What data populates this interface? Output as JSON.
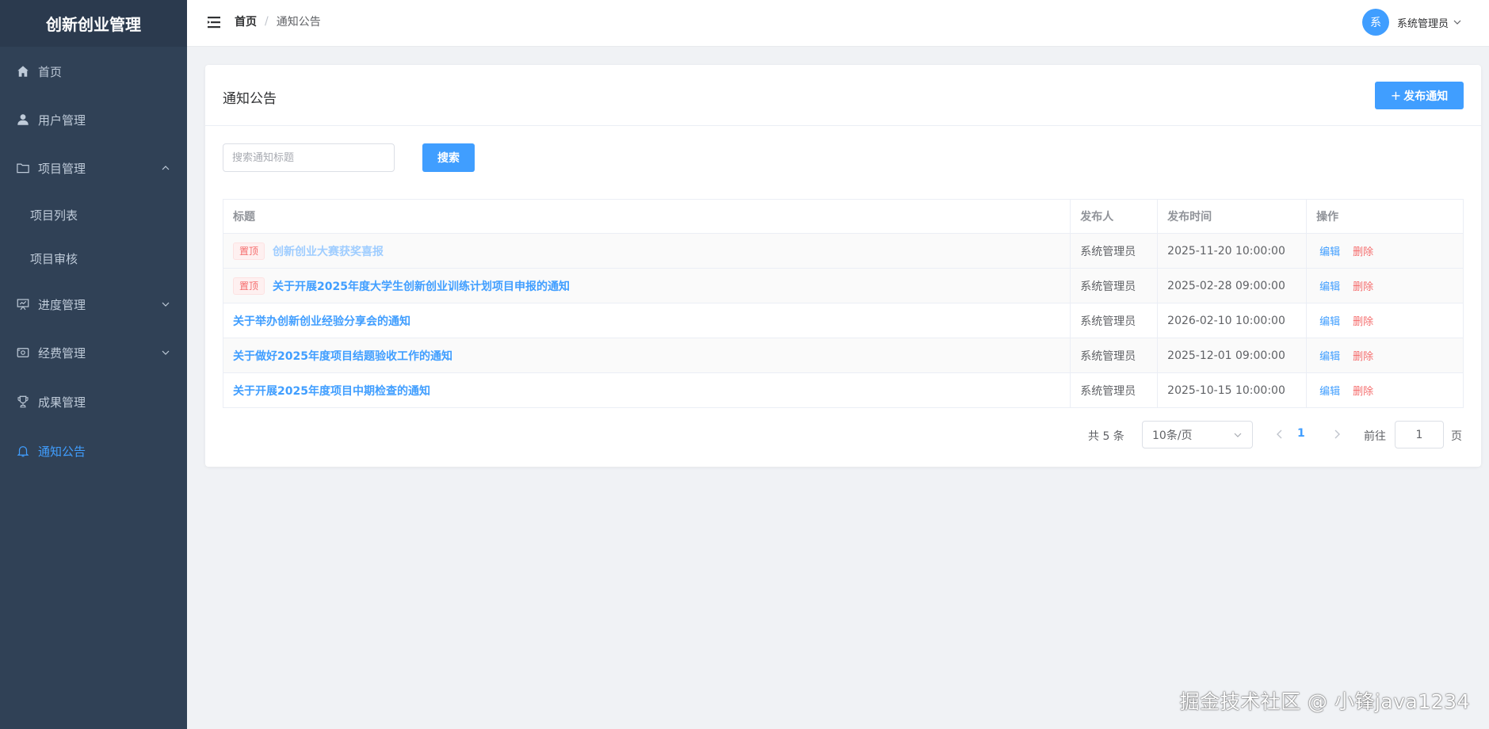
{
  "app": {
    "title": "创新创业管理"
  },
  "sidebar": {
    "items": [
      {
        "label": "首页",
        "icon": "home-icon"
      },
      {
        "label": "用户管理",
        "icon": "user-icon"
      },
      {
        "label": "项目管理",
        "icon": "folder-icon",
        "expanded": true
      },
      {
        "label": "项目列表",
        "sub": true
      },
      {
        "label": "项目审核",
        "sub": true
      },
      {
        "label": "进度管理",
        "icon": "presentation-icon",
        "expanded": false
      },
      {
        "label": "经费管理",
        "icon": "wallet-icon",
        "expanded": false
      },
      {
        "label": "成果管理",
        "icon": "trophy-icon"
      },
      {
        "label": "通知公告",
        "icon": "bell-icon",
        "active": true
      }
    ]
  },
  "header": {
    "breadcrumb": {
      "home": "首页",
      "separator": "/",
      "current": "通知公告"
    },
    "user": {
      "avatar_text": "系",
      "name": "系统管理员"
    }
  },
  "card": {
    "title": "通知公告",
    "publish_label": "发布通知",
    "publish_plus": "+"
  },
  "search": {
    "placeholder": "搜索通知标题",
    "value": "",
    "button": "搜索"
  },
  "table": {
    "headers": {
      "title": "标题",
      "publisher": "发布人",
      "time": "发布时间",
      "ops": "操作"
    },
    "pin_label": "置顶",
    "edit_label": "编辑",
    "delete_label": "删除",
    "rows": [
      {
        "pinned": true,
        "title": "创新创业大赛获奖喜报",
        "publisher": "系统管理员",
        "time": "2025-11-20 10:00:00",
        "muted": true
      },
      {
        "pinned": true,
        "title": "关于开展2025年度大学生创新创业训练计划项目申报的通知",
        "publisher": "系统管理员",
        "time": "2025-02-28 09:00:00"
      },
      {
        "pinned": false,
        "title": "关于举办创新创业经验分享会的通知",
        "publisher": "系统管理员",
        "time": "2026-02-10 10:00:00"
      },
      {
        "pinned": false,
        "title": "关于做好2025年度项目结题验收工作的通知",
        "publisher": "系统管理员",
        "time": "2025-12-01 09:00:00"
      },
      {
        "pinned": false,
        "title": "关于开展2025年度项目中期检查的通知",
        "publisher": "系统管理员",
        "time": "2025-10-15 10:00:00"
      }
    ]
  },
  "pagination": {
    "total": "共 5 条",
    "page_size": "10条/页",
    "current_page": "1",
    "goto_label": "前往",
    "goto_value": "1",
    "page_suffix": "页"
  },
  "watermark": "掘金技术社区 @ 小锋java1234",
  "colors": {
    "sidebar_bg": "#304156",
    "primary": "#409eff",
    "danger": "#f56c6c"
  }
}
